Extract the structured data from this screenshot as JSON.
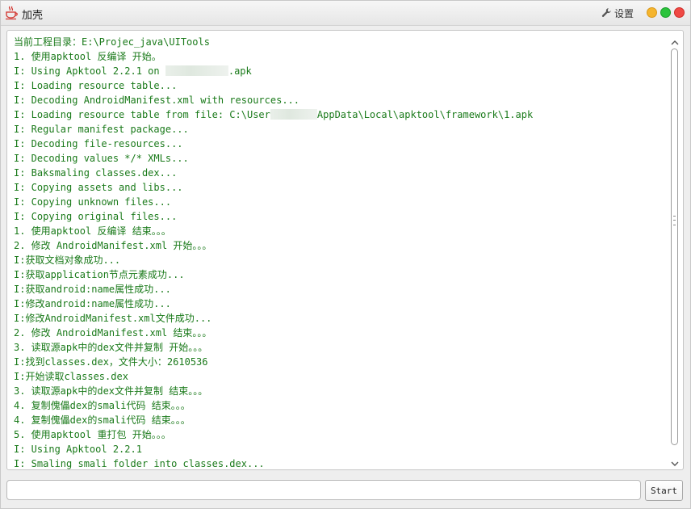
{
  "window": {
    "title": "加壳",
    "settings_label": "设置"
  },
  "log": {
    "lines": [
      {
        "text": "当前工程目录：E:\\Projec_java\\UITools"
      },
      {
        "text": "1. 使用apktool 反编译 开始。"
      },
      {
        "before": "I: Using Apktool 2.2.1 on ",
        "after": ".apk",
        "redacted": true
      },
      {
        "text": "I: Loading resource table..."
      },
      {
        "text": "I: Decoding AndroidManifest.xml with resources..."
      },
      {
        "before": "I: Loading resource table from file: C:\\User",
        "after": "AppData\\Local\\apktool\\framework\\1.apk",
        "redacted": true
      },
      {
        "text": "I: Regular manifest package..."
      },
      {
        "text": "I: Decoding file-resources..."
      },
      {
        "text": "I: Decoding values */* XMLs..."
      },
      {
        "text": "I: Baksmaling classes.dex..."
      },
      {
        "text": "I: Copying assets and libs..."
      },
      {
        "text": "I: Copying unknown files..."
      },
      {
        "text": "I: Copying original files..."
      },
      {
        "text": "1. 使用apktool 反编译 结束。。。"
      },
      {
        "text": "2. 修改 AndroidManifest.xml 开始。。。"
      },
      {
        "text": "I:获取文档对象成功..."
      },
      {
        "text": "I:获取application节点元素成功..."
      },
      {
        "text": "I:获取android:name属性成功..."
      },
      {
        "text": "I:修改android:name属性成功..."
      },
      {
        "text": "I:修改AndroidManifest.xml文件成功..."
      },
      {
        "text": "2. 修改 AndroidManifest.xml 结束。。。"
      },
      {
        "text": "3. 读取源apk中的dex文件并复制 开始。。。"
      },
      {
        "text": "I:找到classes.dex，文件大小：2610536"
      },
      {
        "text": "I:开始读取classes.dex"
      },
      {
        "text": "3. 读取源apk中的dex文件并复制 结束。。。"
      },
      {
        "text": "4. 复制傀儡dex的smali代码 结束。。。"
      },
      {
        "text": "4. 复制傀儡dex的smali代码 结束。。。"
      },
      {
        "text": "5. 使用apktool 重打包 开始。。。"
      },
      {
        "text": "I: Using Apktool 2.2.1"
      },
      {
        "text": "I: Smaling smali folder into classes.dex..."
      }
    ]
  },
  "command": {
    "value": "",
    "placeholder": ""
  },
  "start_button": {
    "label": "Start"
  },
  "colors": {
    "log_text": "#1a7a1a",
    "min": "#f5b52e",
    "max": "#2bc33c",
    "close": "#ef4a45"
  },
  "icons": {
    "app": "java-cup-icon",
    "settings": "wrench-icon"
  }
}
